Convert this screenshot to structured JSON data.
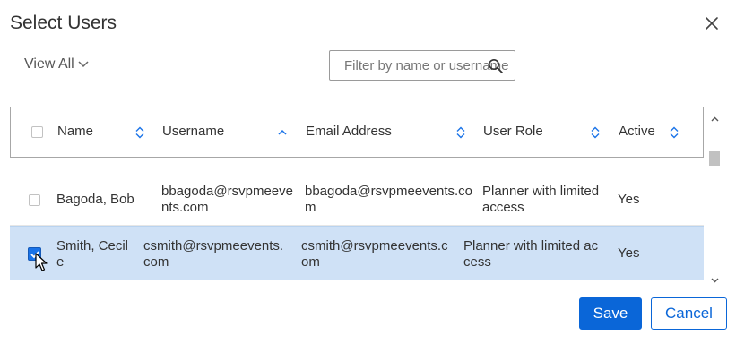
{
  "dialog": {
    "title": "Select Users",
    "close_icon": "close-icon"
  },
  "toolbar": {
    "view_all_label": "View All",
    "filter_placeholder": "Filter by name or username",
    "filter_value": ""
  },
  "table": {
    "columns": [
      {
        "label": "Name",
        "sort": "none"
      },
      {
        "label": "Username",
        "sort": "ascending"
      },
      {
        "label": "Email Address",
        "sort": "none"
      },
      {
        "label": "User Role",
        "sort": "none"
      },
      {
        "label": "Active",
        "sort": "none"
      }
    ],
    "rows": [
      {
        "selected": false,
        "name": [
          "Bagoda, Bob"
        ],
        "username": [
          "bbagoda@rsvpmeeve",
          "nts.com"
        ],
        "email": [
          "bbagoda@rsvpmeevents.co",
          "m"
        ],
        "role": [
          "Planner with limited",
          "access"
        ],
        "active": "Yes"
      },
      {
        "selected": true,
        "name": [
          "Smith, Cecil",
          "e"
        ],
        "username": [
          "csmith@rsvpmeevents.",
          "com"
        ],
        "email": [
          "csmith@rsvpmeevents.c",
          "om"
        ],
        "role": [
          "Planner with limited ac",
          "cess"
        ],
        "active": "Yes"
      }
    ]
  },
  "buttons": {
    "save": "Save",
    "cancel": "Cancel"
  },
  "colors": {
    "accent": "#0a66d8",
    "selected_row": "#cfe1f6"
  }
}
